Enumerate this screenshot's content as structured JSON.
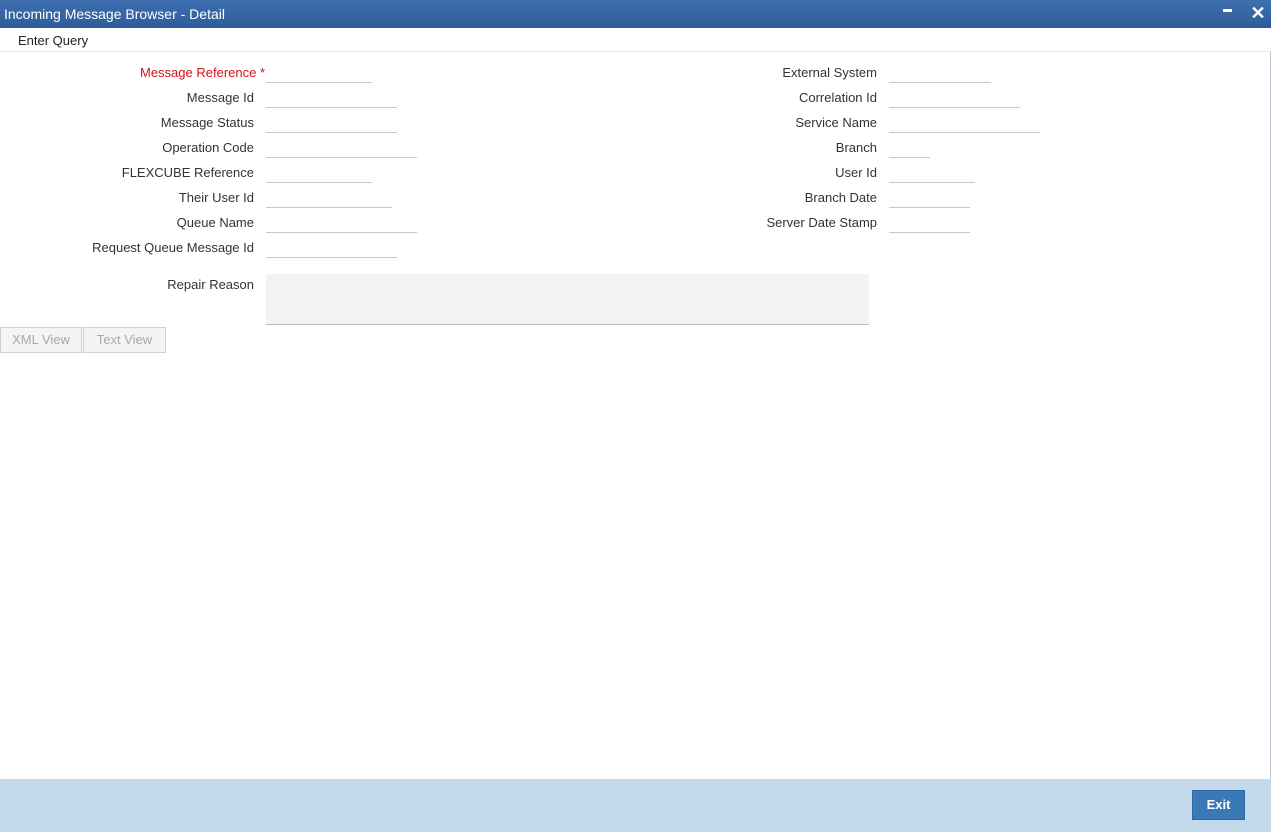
{
  "window": {
    "title": "Incoming Message Browser - Detail"
  },
  "titlebar_controls": {
    "minimize_icon": "minimize-icon",
    "close_icon": "close-icon",
    "close_glyph": "✕"
  },
  "toolbar": {
    "enter_query": "Enter Query"
  },
  "left_fields": [
    {
      "label": "Message Reference",
      "required_mark": "*",
      "value": ""
    },
    {
      "label": "Message Id",
      "value": ""
    },
    {
      "label": "Message Status",
      "value": ""
    },
    {
      "label": "Operation Code",
      "value": ""
    },
    {
      "label": "FLEXCUBE Reference",
      "value": ""
    },
    {
      "label": "Their User Id",
      "value": ""
    },
    {
      "label": "Queue Name",
      "value": ""
    },
    {
      "label": "Request Queue Message Id",
      "value": ""
    }
  ],
  "right_fields": [
    {
      "label": "External System",
      "value": ""
    },
    {
      "label": "Correlation Id",
      "value": ""
    },
    {
      "label": "Service Name",
      "value": ""
    },
    {
      "label": "Branch",
      "value": ""
    },
    {
      "label": "User Id",
      "value": ""
    },
    {
      "label": "Branch Date",
      "value": ""
    },
    {
      "label": "Server Date Stamp",
      "value": ""
    }
  ],
  "repair_reason": {
    "label": "Repair Reason",
    "value": ""
  },
  "view_buttons": {
    "xml_view": "XML View",
    "text_view": "Text View"
  },
  "footer": {
    "exit": "Exit"
  },
  "colors": {
    "titlebar": "#2e5c9a",
    "required": "#d0121b",
    "footer": "#c4d9ec",
    "exit_button": "#3a79b5"
  }
}
